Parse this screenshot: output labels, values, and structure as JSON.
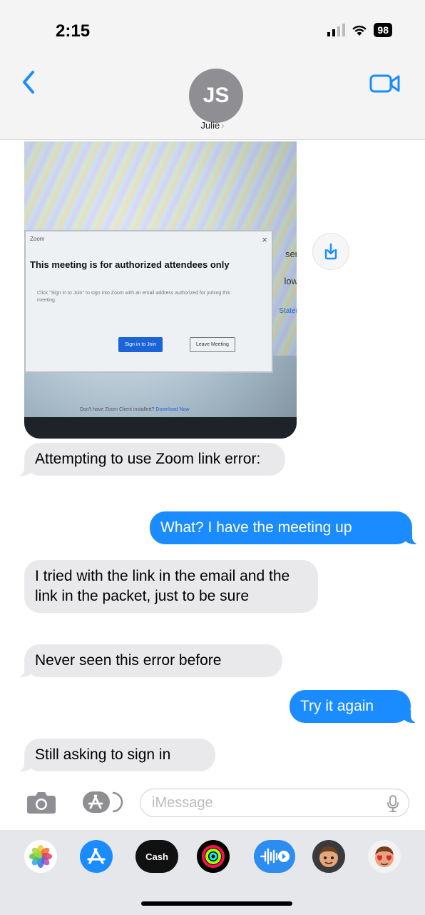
{
  "status_bar": {
    "time": "2:15",
    "battery": "98"
  },
  "header": {
    "avatar_initials": "JS",
    "contact_name": "Julie",
    "contact_chevron": "›"
  },
  "photo": {
    "dialog_app": "Zoom",
    "dialog_close": "×",
    "dialog_title": "This meeting is for authorized attendees only",
    "dialog_body": "Click \"Sign in to Join\" to sign into Zoom with an email address authorized for joining this meeting.",
    "sign_in_button": "Sign in to Join",
    "leave_button": "Leave Meeting",
    "side_text_1": "ser",
    "side_text_2": "low",
    "side_text_3": "Stater",
    "footer_text": "Don't have Zoom Client installed?",
    "footer_link": "Download Now"
  },
  "messages": [
    {
      "text": "Attempting to use Zoom link error:",
      "from": "them"
    },
    {
      "text": "What? I have the meeting up",
      "from": "me"
    },
    {
      "text": "I tried with the link in the email and the link in the packet, just to be sure",
      "from": "them"
    },
    {
      "text": "Never seen this error before",
      "from": "them"
    },
    {
      "text": "Try it again",
      "from": "me"
    },
    {
      "text": "Still asking to sign in",
      "from": "them"
    }
  ],
  "input": {
    "placeholder": "iMessage"
  },
  "app_strip": {
    "apps": [
      "photos-app",
      "app-store",
      "apple-cash",
      "activity",
      "audio-message",
      "memoji",
      "memoji-stickers"
    ],
    "cash_label": "Cash"
  },
  "colors": {
    "accent": "#1a8cff",
    "incoming_bubble": "#e9e9eb",
    "nav_background": "#f4f4f4"
  }
}
